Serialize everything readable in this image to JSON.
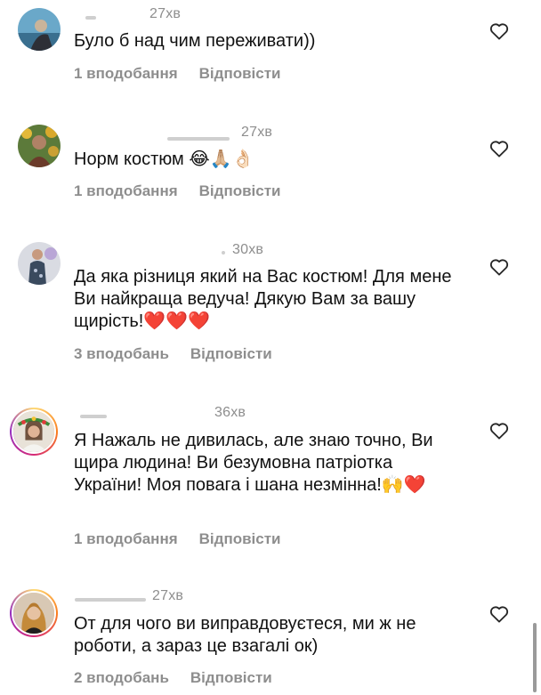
{
  "comments": [
    {
      "time": "27хв",
      "text": "Було б над чим переживати))",
      "likes": "1 вподобання",
      "reply": "Відповісти",
      "avatar_icon": "user-photo-avatar"
    },
    {
      "time": "27хв",
      "text": "Норм костюм 😂🙏🏼👌🏻",
      "likes": "1 вподобання",
      "reply": "Відповісти",
      "avatar_icon": "user-photo-avatar"
    },
    {
      "time": "30хв",
      "text": "Да яка різниця який на Вас костюм! Для мене Ви найкраща ведуча! Дякую Вам за вашу щирість!❤️❤️❤️",
      "likes": "3 вподобань",
      "reply": "Відповісти",
      "avatar_icon": "user-photo-avatar"
    },
    {
      "time": "36хв",
      "text": "Я Нажаль не дивилась, але знаю точно, Ви щира людина! Ви безумовна патріотка України! Моя повага і шана незмінна!🙌❤️",
      "likes": "1 вподобання",
      "reply": "Відповісти",
      "avatar_icon": "user-photo-avatar-story-ring"
    },
    {
      "time": "27хв",
      "text": "От для чого ви виправдовуєтеся, ми ж не роботи, а зараз це взагалі ок)",
      "likes": "2 вподобань",
      "reply": "Відповісти",
      "avatar_icon": "user-photo-avatar-story-ring"
    }
  ],
  "icons": {
    "like": "heart-outline-icon"
  },
  "colors": {
    "text": "#111111",
    "secondary": "#8e8e8e",
    "story_ring": [
      "#feda75",
      "#fa7e1e",
      "#d62976",
      "#962fbf"
    ]
  }
}
